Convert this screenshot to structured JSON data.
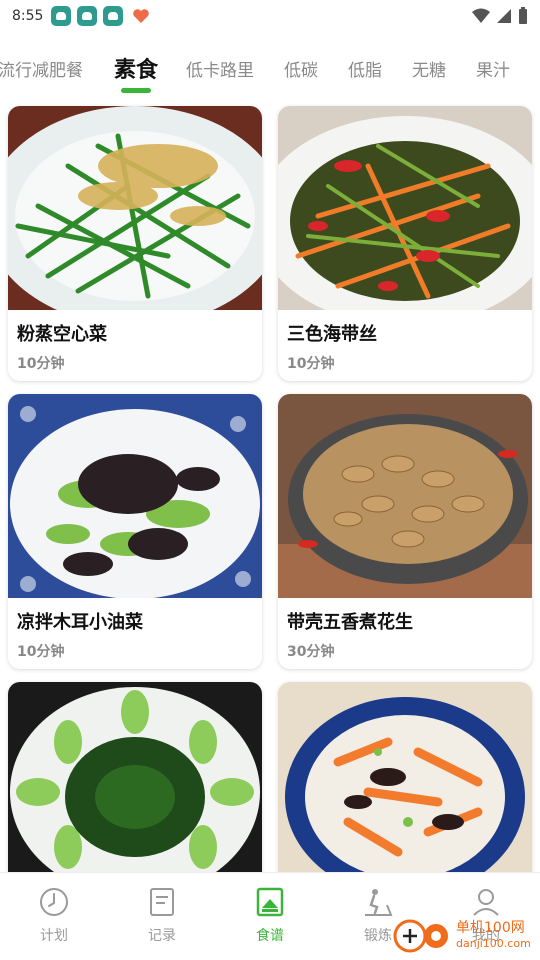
{
  "status_bar": {
    "time": "8:55"
  },
  "tabs": [
    {
      "label": "流行减肥餐",
      "active": false
    },
    {
      "label": "素食",
      "active": true
    },
    {
      "label": "低卡路里",
      "active": false
    },
    {
      "label": "低碳",
      "active": false
    },
    {
      "label": "低脂",
      "active": false
    },
    {
      "label": "无糖",
      "active": false
    },
    {
      "label": "果汁",
      "active": false
    }
  ],
  "recipes": [
    {
      "title": "粉蒸空心菜",
      "time": "10分钟"
    },
    {
      "title": "三色海带丝",
      "time": "10分钟"
    },
    {
      "title": "凉拌木耳小油菜",
      "time": "10分钟"
    },
    {
      "title": "带壳五香煮花生",
      "time": "30分钟"
    },
    {
      "title": "",
      "time": ""
    },
    {
      "title": "",
      "time": ""
    }
  ],
  "bottom_nav": [
    {
      "label": "计划",
      "icon": "clock-icon",
      "active": false
    },
    {
      "label": "记录",
      "icon": "note-icon",
      "active": false
    },
    {
      "label": "食谱",
      "icon": "recipe-icon",
      "active": true
    },
    {
      "label": "锻炼",
      "icon": "treadmill-icon",
      "active": false
    },
    {
      "label": "我的",
      "icon": "person-icon",
      "active": false
    }
  ],
  "watermark": {
    "line1": "单机100网",
    "line2": "danji100.com"
  },
  "colors": {
    "accent": "#3ab53a",
    "text_muted": "#8a8a8a",
    "watermark": "#f06b1a"
  }
}
